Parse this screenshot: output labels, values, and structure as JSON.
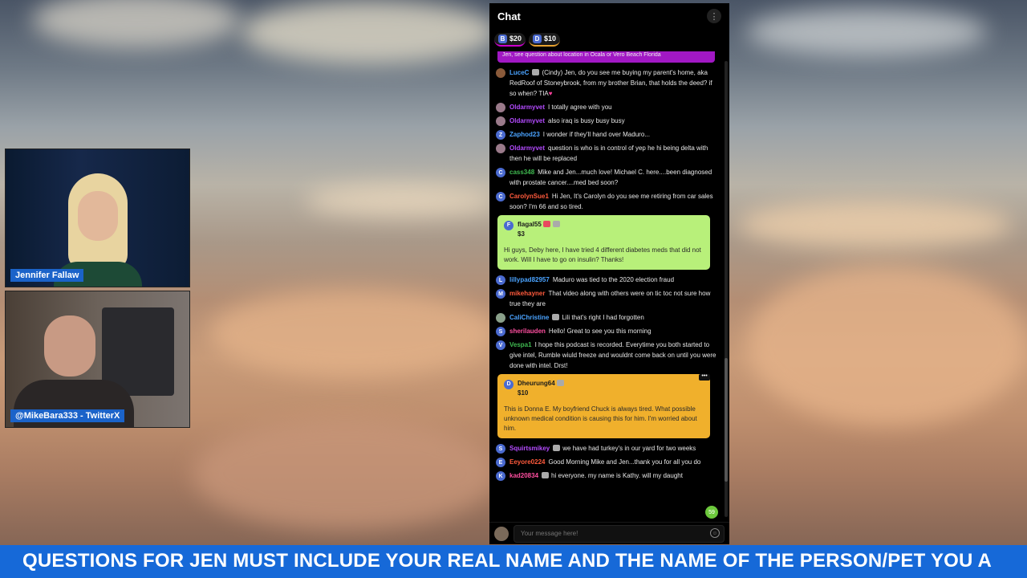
{
  "cams": {
    "host1_label": "Jennifer Fallaw",
    "host2_label": "@MikeBara333 - TwitterX"
  },
  "chat": {
    "title": "Chat",
    "menu_icon": "kebab-icon",
    "rant_chips": [
      {
        "amount": "$20",
        "icon": "B"
      },
      {
        "amount": "$10",
        "icon": "D"
      }
    ],
    "pinned_text": "Jen, see question about location in Ocala or Vero Beach Florida",
    "messages": [
      {
        "avatar": "",
        "avatar_color": "#8a5a3a",
        "user": "LuceC",
        "user_color": "#4aa3ff",
        "text": "(Cindy) Jen, do you see me buying my parent's home, aka RedRoof of Stoneybrook, from my brother Brian, that holds the deed? if so when? TIA",
        "heart": "♥",
        "badge": true
      },
      {
        "avatar": "",
        "avatar_color": "#9a7a8a",
        "user": "Oldarmyvet",
        "user_color": "#b44bff",
        "text": "I totally agree with you"
      },
      {
        "avatar": "",
        "avatar_color": "#9a7a8a",
        "user": "Oldarmyvet",
        "user_color": "#b44bff",
        "text": "also iraq is busy busy busy"
      },
      {
        "avatar": "Z",
        "avatar_color": "#4a6ad0",
        "user": "Zaphod23",
        "user_color": "#4aa3ff",
        "text": "I wonder if they'll hand over Maduro..."
      },
      {
        "avatar": "",
        "avatar_color": "#9a7a8a",
        "user": "Oldarmyvet",
        "user_color": "#b44bff",
        "text": "question is who is in control of yep he hi being delta with then he will be replaced"
      },
      {
        "avatar": "C",
        "avatar_color": "#4a6ad0",
        "user": "cass348",
        "user_color": "#3fb950",
        "text": "Mike and Jen...much love! Michael C. here....been diagnosed with prostate cancer....med bed soon?"
      },
      {
        "avatar": "C",
        "avatar_color": "#4a6ad0",
        "user": "CarolynSue1",
        "user_color": "#ff5a3c",
        "text": "Hi Jen, It's Carolyn do you see me retiring from car sales soon? I'm 66 and so tired."
      }
    ],
    "rant1": {
      "avatar": "F",
      "user": "flagal55",
      "amount": "$3",
      "text": "Hi guys, Deby here, I have tried 4 different diabetes meds that did not work. Will I have to go on insulin? Thanks!"
    },
    "messages2": [
      {
        "avatar": "L",
        "avatar_color": "#4a6ad0",
        "user": "lillypad82957",
        "user_color": "#4aa3ff",
        "text": "Maduro was tied to the 2020 election fraud"
      },
      {
        "avatar": "M",
        "avatar_color": "#4a6ad0",
        "user": "mikehayner",
        "user_color": "#ff5a3c",
        "text": "That video along with others were on tic toc not sure how true they are"
      },
      {
        "avatar": "",
        "avatar_color": "#8aa08a",
        "user": "CaliChristine",
        "user_color": "#4aa3ff",
        "text": "Lili that's right I had forgotten",
        "badge": true
      },
      {
        "avatar": "S",
        "avatar_color": "#4a6ad0",
        "user": "sherilauden",
        "user_color": "#ff4fa0",
        "text": "Hello! Great to see you this morning"
      },
      {
        "avatar": "V",
        "avatar_color": "#4a6ad0",
        "user": "Vespa1",
        "user_color": "#3fb950",
        "text": "I hope this podcast is recorded. Everytime you both started to give intel, Rumble wiuld freeze and wouldnt come back on until you were done with intel. Drst!"
      }
    ],
    "rant2": {
      "avatar": "D",
      "user": "Dheurung64",
      "amount": "$10",
      "text": "This is Donna E. My boyfriend Chuck is always tired. What possible unknown medical condition is causing this for him. I'm worried about him."
    },
    "messages3": [
      {
        "avatar": "S",
        "avatar_color": "#4a6ad0",
        "user": "Squirtsmikey",
        "user_color": "#b44bff",
        "text": "we have had turkey's in our yard for two weeks",
        "badge": true
      },
      {
        "avatar": "E",
        "avatar_color": "#4a6ad0",
        "user": "Eeyore0224",
        "user_color": "#ff5a3c",
        "text": "Good Morning Mike and Jen...thank you for all you do"
      },
      {
        "avatar": "K",
        "avatar_color": "#4a6ad0",
        "user": "kad20834",
        "user_color": "#ff4fa0",
        "text": "hi everyone. my name is Kathy. will my daught",
        "badge": true
      }
    ],
    "new_count": "59",
    "composer_placeholder": "Your message here!"
  },
  "ticker": {
    "text": "QUESTIONS FOR JEN MUST INCLUDE YOUR REAL NAME AND THE NAME OF THE PERSON/PET YOU A"
  }
}
